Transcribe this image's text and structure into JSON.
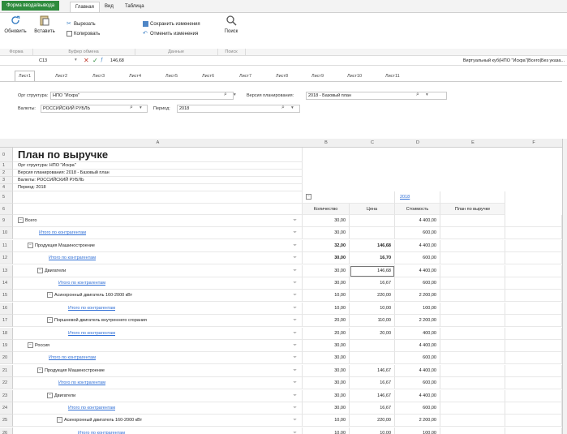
{
  "ribbon_tabs": {
    "forma": "Форма ввода/вывода",
    "tabs": [
      "Главная",
      "Вид",
      "Таблица"
    ]
  },
  "ribbon": {
    "refresh": "Обновить",
    "paste": "Вставить",
    "cut": "Вырезать",
    "copy": "Копировать",
    "save_changes": "Сохранить изменения",
    "cancel_changes": "Отменить изменения",
    "search": "Поиск",
    "groups": [
      "Форма",
      "Буфер обмена",
      "Данные",
      "Поиск"
    ]
  },
  "formula_bar": {
    "cell_ref": "C13",
    "value": "146,68",
    "path": "Виртуальный куб(НПО \"Искра\"|Всего|Без указа..."
  },
  "sheet_tabs": [
    "Лист1",
    "Лист2",
    "Лист3",
    "Лист4",
    "Лист5",
    "Лист6",
    "Лист7",
    "Лист8",
    "Лист9",
    "Лист10",
    "Лист11"
  ],
  "params": {
    "org_label": "Орг структура:",
    "org_value": "НПО \"Искра\"",
    "version_label": "Версия планирования:",
    "version_value": "2018 - Базовый план",
    "currency_label": "Валюты:",
    "currency_value": "РОССИЙСКИЙ РУБЛЬ",
    "period_label": "Период:",
    "period_value": "2018"
  },
  "columns": [
    "A",
    "B",
    "C",
    "D",
    "E",
    "F"
  ],
  "sheet": {
    "title": "План по выручке",
    "info": [
      "Орг структура: НПО \"Искра\"",
      "Версия планирования: 2018 - Базовый план",
      "Валюты: РОССИЙСКИЙ РУБЛЬ",
      "Период: 2018"
    ],
    "year_header": "2018",
    "col_headers": [
      "Количество",
      "Цена",
      "Стоимость",
      "План по выручке"
    ]
  },
  "row_numbers": [
    "0",
    "1",
    "2",
    "3",
    "4",
    "5",
    "6"
  ],
  "rows": [
    {
      "n": "9",
      "label": "Всего",
      "indent": 0,
      "exp": true,
      "link": false,
      "b": "30,00",
      "c": "",
      "d": "4 400,00",
      "bold": false
    },
    {
      "n": "10",
      "label": "Итого по контрагентам",
      "indent": 1,
      "exp": false,
      "link": true,
      "b": "30,00",
      "c": "",
      "d": "600,00",
      "bold": false
    },
    {
      "n": "11",
      "label": "Продукция Машиностроение",
      "indent": 1,
      "exp": true,
      "link": false,
      "b": "32,00",
      "c": "146,68",
      "d": "4 400,00",
      "bold": true
    },
    {
      "n": "12",
      "label": "Итого по контрагентам",
      "indent": 2,
      "exp": false,
      "link": true,
      "b": "30,00",
      "c": "16,70",
      "d": "600,00",
      "bold": true
    },
    {
      "n": "13",
      "label": "Двигатели",
      "indent": 2,
      "exp": true,
      "link": false,
      "b": "30,00",
      "c": "146,68",
      "d": "4 400,00",
      "bold": false
    },
    {
      "n": "14",
      "label": "Итого по контрагентам",
      "indent": 3,
      "exp": false,
      "link": true,
      "b": "30,00",
      "c": "16,67",
      "d": "600,00",
      "bold": false
    },
    {
      "n": "15",
      "label": "Асинхронный двигатель 160-2000 кВт",
      "indent": 3,
      "exp": true,
      "link": false,
      "b": "10,00",
      "c": "220,00",
      "d": "2 200,00",
      "bold": false
    },
    {
      "n": "16",
      "label": "Итого по контрагентам",
      "indent": 4,
      "exp": false,
      "link": true,
      "b": "10,00",
      "c": "10,00",
      "d": "100,00",
      "bold": false
    },
    {
      "n": "17",
      "label": "Поршневой двигатель внутреннего сгорания",
      "indent": 3,
      "exp": true,
      "link": false,
      "b": "20,00",
      "c": "110,00",
      "d": "2 200,00",
      "bold": false
    },
    {
      "n": "18",
      "label": "Итого по контрагентам",
      "indent": 4,
      "exp": false,
      "link": true,
      "b": "20,00",
      "c": "20,00",
      "d": "400,00",
      "bold": false
    },
    {
      "n": "19",
      "label": "Россия",
      "indent": 1,
      "exp": true,
      "link": false,
      "b": "30,00",
      "c": "",
      "d": "4 400,00",
      "bold": false
    },
    {
      "n": "20",
      "label": "Итого по контрагентам",
      "indent": 2,
      "exp": false,
      "link": true,
      "b": "30,00",
      "c": "",
      "d": "600,00",
      "bold": false
    },
    {
      "n": "21",
      "label": "Продукция Машиностроение",
      "indent": 2,
      "exp": true,
      "link": false,
      "b": "30,00",
      "c": "146,67",
      "d": "4 400,00",
      "bold": false
    },
    {
      "n": "22",
      "label": "Итого по контрагентам",
      "indent": 3,
      "exp": false,
      "link": true,
      "b": "30,00",
      "c": "16,67",
      "d": "600,00",
      "bold": false
    },
    {
      "n": "23",
      "label": "Двигатели",
      "indent": 3,
      "exp": true,
      "link": false,
      "b": "30,00",
      "c": "146,67",
      "d": "4 400,00",
      "bold": false
    },
    {
      "n": "24",
      "label": "Итого по контрагентам",
      "indent": 4,
      "exp": false,
      "link": true,
      "b": "30,00",
      "c": "16,67",
      "d": "600,00",
      "bold": false
    },
    {
      "n": "25",
      "label": "Асинхронный двигатель 160-2000 кВт",
      "indent": 4,
      "exp": true,
      "link": false,
      "b": "10,00",
      "c": "220,00",
      "d": "2 200,00",
      "bold": false
    },
    {
      "n": "26",
      "label": "Итого по контрагентам",
      "indent": 5,
      "exp": false,
      "link": true,
      "b": "10,00",
      "c": "10,00",
      "d": "100,00",
      "bold": false
    }
  ],
  "colors": {
    "accent": "#2e8b3d",
    "link": "#2f6fd6",
    "header_bg": "#f0f0f0"
  }
}
